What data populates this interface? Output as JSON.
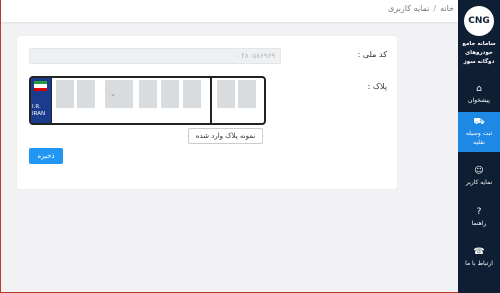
{
  "breadcrumb": {
    "home": "خانه",
    "separator": "/",
    "current": "نمایه کاربری"
  },
  "form": {
    "national_id_label": "کد ملی :",
    "national_id_value": "۰۴۸۰۵۸۶۹۶۹",
    "plate_label": "پلاک :",
    "plate_country_line1": "I.R.",
    "plate_country_line2": "IRAN",
    "sample_plate_button": "نمونه پلاک وارد شده",
    "save_button": "ذخیره"
  },
  "sidebar": {
    "logo": "CNG",
    "app_title_line1": "سامانه جامع",
    "app_title_line2": "خودروهای",
    "app_title_line3": "دوگانه سوز",
    "items": [
      {
        "label": "پیشخوان",
        "icon": "home-icon",
        "active": false
      },
      {
        "label_line1": "ثبت وسیله",
        "label_line2": "نقلیه",
        "icon": "car-icon",
        "active": true
      },
      {
        "label": "نمایه کاربر",
        "icon": "user-icon",
        "active": false
      },
      {
        "label": "راهنما",
        "icon": "help-icon",
        "active": false
      },
      {
        "label": "ارتباط با ما",
        "icon": "contact-icon",
        "active": false
      }
    ]
  },
  "colors": {
    "sidebar_bg": "#0f1f33",
    "active_item": "#1e88e5",
    "save_button": "#2196f3",
    "plate_blue": "#1b3b8f",
    "frame_border": "#c0392b"
  }
}
